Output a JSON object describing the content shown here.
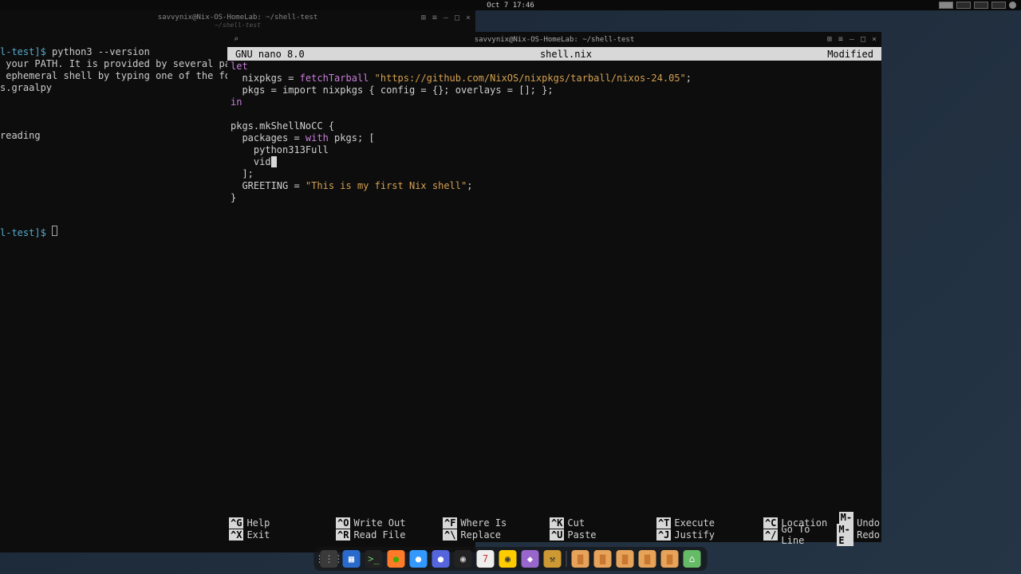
{
  "topbar": {
    "datetime": "Oct 7  17:46"
  },
  "back_term": {
    "title": "savvynix@Nix-OS-HomeLab: ~/shell-test",
    "subtitle": "~/shell-test",
    "lines": {
      "l1a": "l-test]$ ",
      "l1b": "python3 --version",
      "l2": " your PATH. It is provided by several pa",
      "l3": " ephemeral shell by typing one of the fo",
      "l4": "s.graalpy",
      "l5": "reading",
      "l6a": "l-test]$ "
    }
  },
  "editor": {
    "title": "savvynix@Nix-OS-HomeLab: ~/shell-test",
    "header_left": "GNU nano 8.0",
    "header_mid": "shell.nix",
    "header_right": "Modified",
    "code": {
      "c1": "let",
      "c2a": "  nixpkgs = ",
      "c2b": "fetchTarball",
      "c2c": " ",
      "c2d": "\"https://github.com/NixOS/nixpkgs/tarball/nixos-24.05\"",
      "c2e": ";",
      "c3": "  pkgs = import nixpkgs { config = {}; overlays = []; };",
      "c4": "in",
      "c5": "",
      "c6": "pkgs.mkShellNoCC {",
      "c7a": "  packages = ",
      "c7b": "with",
      "c7c": " pkgs; [",
      "c8": "    python313Full",
      "c9": "    vid",
      "c10": "  ];",
      "c11a": "  GREETING = ",
      "c11b": "\"This is my first Nix shell\"",
      "c11c": ";",
      "c12": "}"
    },
    "footer": [
      {
        "k": "^G",
        "l": "Help"
      },
      {
        "k": "^O",
        "l": "Write Out"
      },
      {
        "k": "^F",
        "l": "Where Is"
      },
      {
        "k": "^K",
        "l": "Cut"
      },
      {
        "k": "^T",
        "l": "Execute"
      },
      {
        "k": "^C",
        "l": "Location"
      },
      {
        "k": "M-U",
        "l": "Undo"
      },
      {
        "k": "^X",
        "l": "Exit"
      },
      {
        "k": "^R",
        "l": "Read File"
      },
      {
        "k": "^\\",
        "l": "Replace"
      },
      {
        "k": "^U",
        "l": "Paste"
      },
      {
        "k": "^J",
        "l": "Justify"
      },
      {
        "k": "^/",
        "l": "Go To Line"
      },
      {
        "k": "M-E",
        "l": "Redo"
      }
    ]
  },
  "dock": {
    "items": [
      {
        "name": "apps-grid",
        "bg": "#3a3a3a",
        "glyph": "⋮⋮⋮",
        "col": "#aaa"
      },
      {
        "name": "files",
        "bg": "#2a6acc",
        "glyph": "▦",
        "col": "#fff"
      },
      {
        "name": "terminal",
        "bg": "#222",
        "glyph": ">_",
        "col": "#6c6"
      },
      {
        "name": "firefox",
        "bg": "#ff7b29",
        "glyph": "●",
        "col": "#4a0"
      },
      {
        "name": "browser-blue",
        "bg": "#3399ff",
        "glyph": "●",
        "col": "#fff"
      },
      {
        "name": "browser-indigo",
        "bg": "#5566dd",
        "glyph": "●",
        "col": "#fff"
      },
      {
        "name": "obs",
        "bg": "#222",
        "glyph": "◉",
        "col": "#ccc"
      },
      {
        "name": "calendar",
        "bg": "#eee",
        "glyph": "7",
        "col": "#c33"
      },
      {
        "name": "music",
        "bg": "#ffcc00",
        "glyph": "◉",
        "col": "#333"
      },
      {
        "name": "purple-app",
        "bg": "#9966cc",
        "glyph": "◆",
        "col": "#fff"
      },
      {
        "name": "dev-app",
        "bg": "#cc9933",
        "glyph": "⚒",
        "col": "#333"
      }
    ],
    "folders": [
      "#e8a35a",
      "#e8a35a",
      "#e8a35a",
      "#e8a35a",
      "#e8a35a"
    ],
    "last": {
      "name": "settings",
      "bg": "#66bb66",
      "glyph": "⌂",
      "col": "#fff"
    }
  }
}
